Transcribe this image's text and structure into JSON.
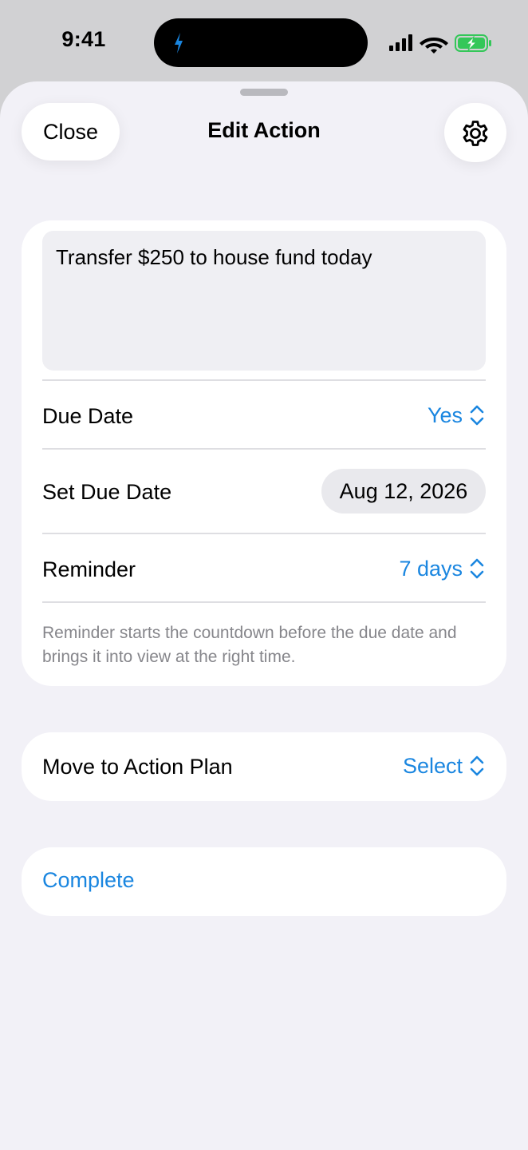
{
  "status_bar": {
    "time": "9:41"
  },
  "header": {
    "close_label": "Close",
    "title": "Edit Action",
    "settings_icon": "gear-icon"
  },
  "action": {
    "text": "Transfer $250 to house fund today"
  },
  "due_date": {
    "label": "Due Date",
    "value": "Yes"
  },
  "set_due_date": {
    "label": "Set Due Date",
    "value": "Aug 12, 2026"
  },
  "reminder": {
    "label": "Reminder",
    "value": "7 days",
    "footnote": "Reminder starts the countdown before the due date and brings it into view at the right time."
  },
  "move": {
    "label": "Move to Action Plan",
    "value": "Select"
  },
  "complete": {
    "label": "Complete"
  },
  "colors": {
    "accent": "#1a86e0",
    "sheet_background": "#f2f1f7",
    "card_background": "#ffffff",
    "battery_green": "#34c759"
  }
}
